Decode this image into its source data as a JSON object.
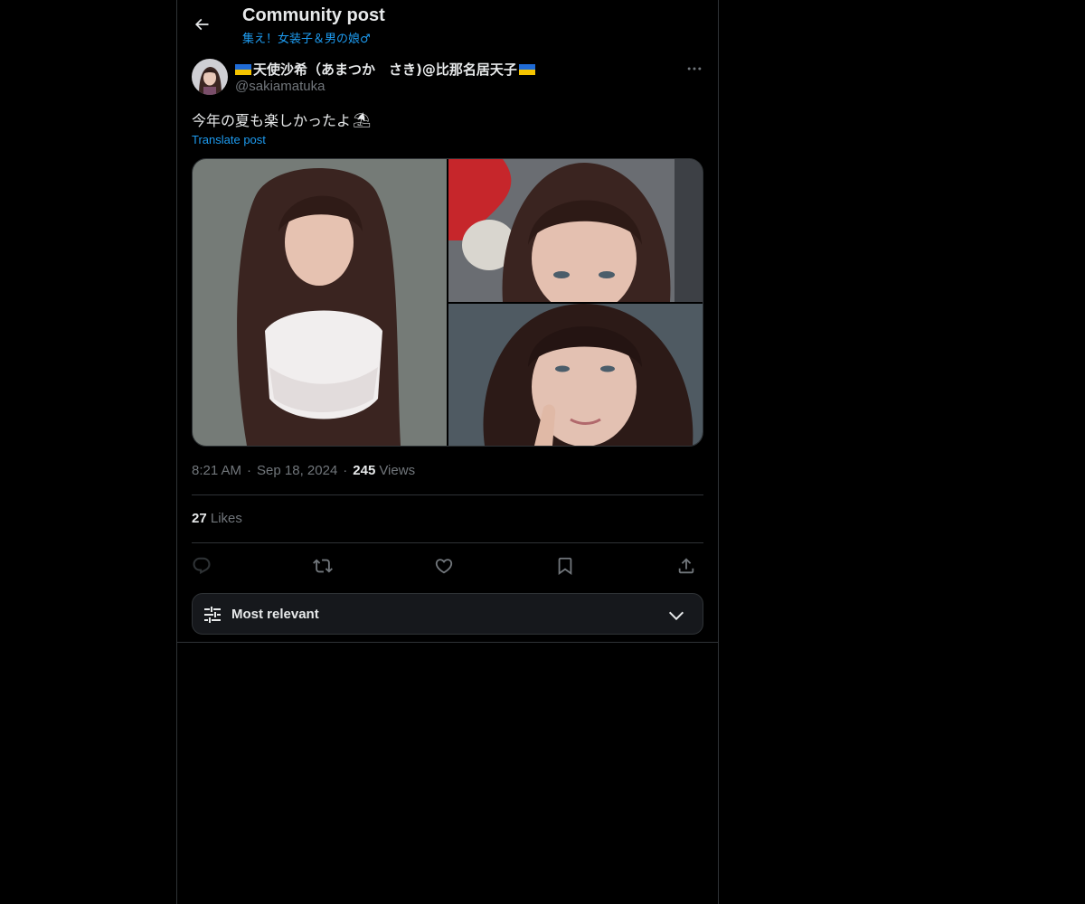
{
  "header": {
    "title": "Community post",
    "community": "集え！女装子＆男の娘♂"
  },
  "author": {
    "display_name": "天使沙希（あまつか　さき)@比那名居天子",
    "handle": "@sakiamatuka",
    "flag_icon": "ukraine-flag-icon"
  },
  "post": {
    "text": "今年の夏も楽しかったよ",
    "emoji": "⛱",
    "translate_label": "Translate post",
    "media_count": 3
  },
  "meta": {
    "time": "8:21 AM",
    "date": "Sep 18, 2024",
    "views_count": "245",
    "views_label": "Views",
    "separator": "·"
  },
  "likes": {
    "count": "27",
    "label": "Likes"
  },
  "actions": {
    "reply": "reply-icon",
    "repost": "repost-icon",
    "like": "heart-icon",
    "bookmark": "bookmark-icon",
    "share": "share-icon"
  },
  "sort": {
    "label": "Most relevant"
  },
  "colors": {
    "accent": "#1d9bf0",
    "background": "#000000",
    "text": "#e7e9ea",
    "muted": "#71767b",
    "border": "#2f3336"
  }
}
